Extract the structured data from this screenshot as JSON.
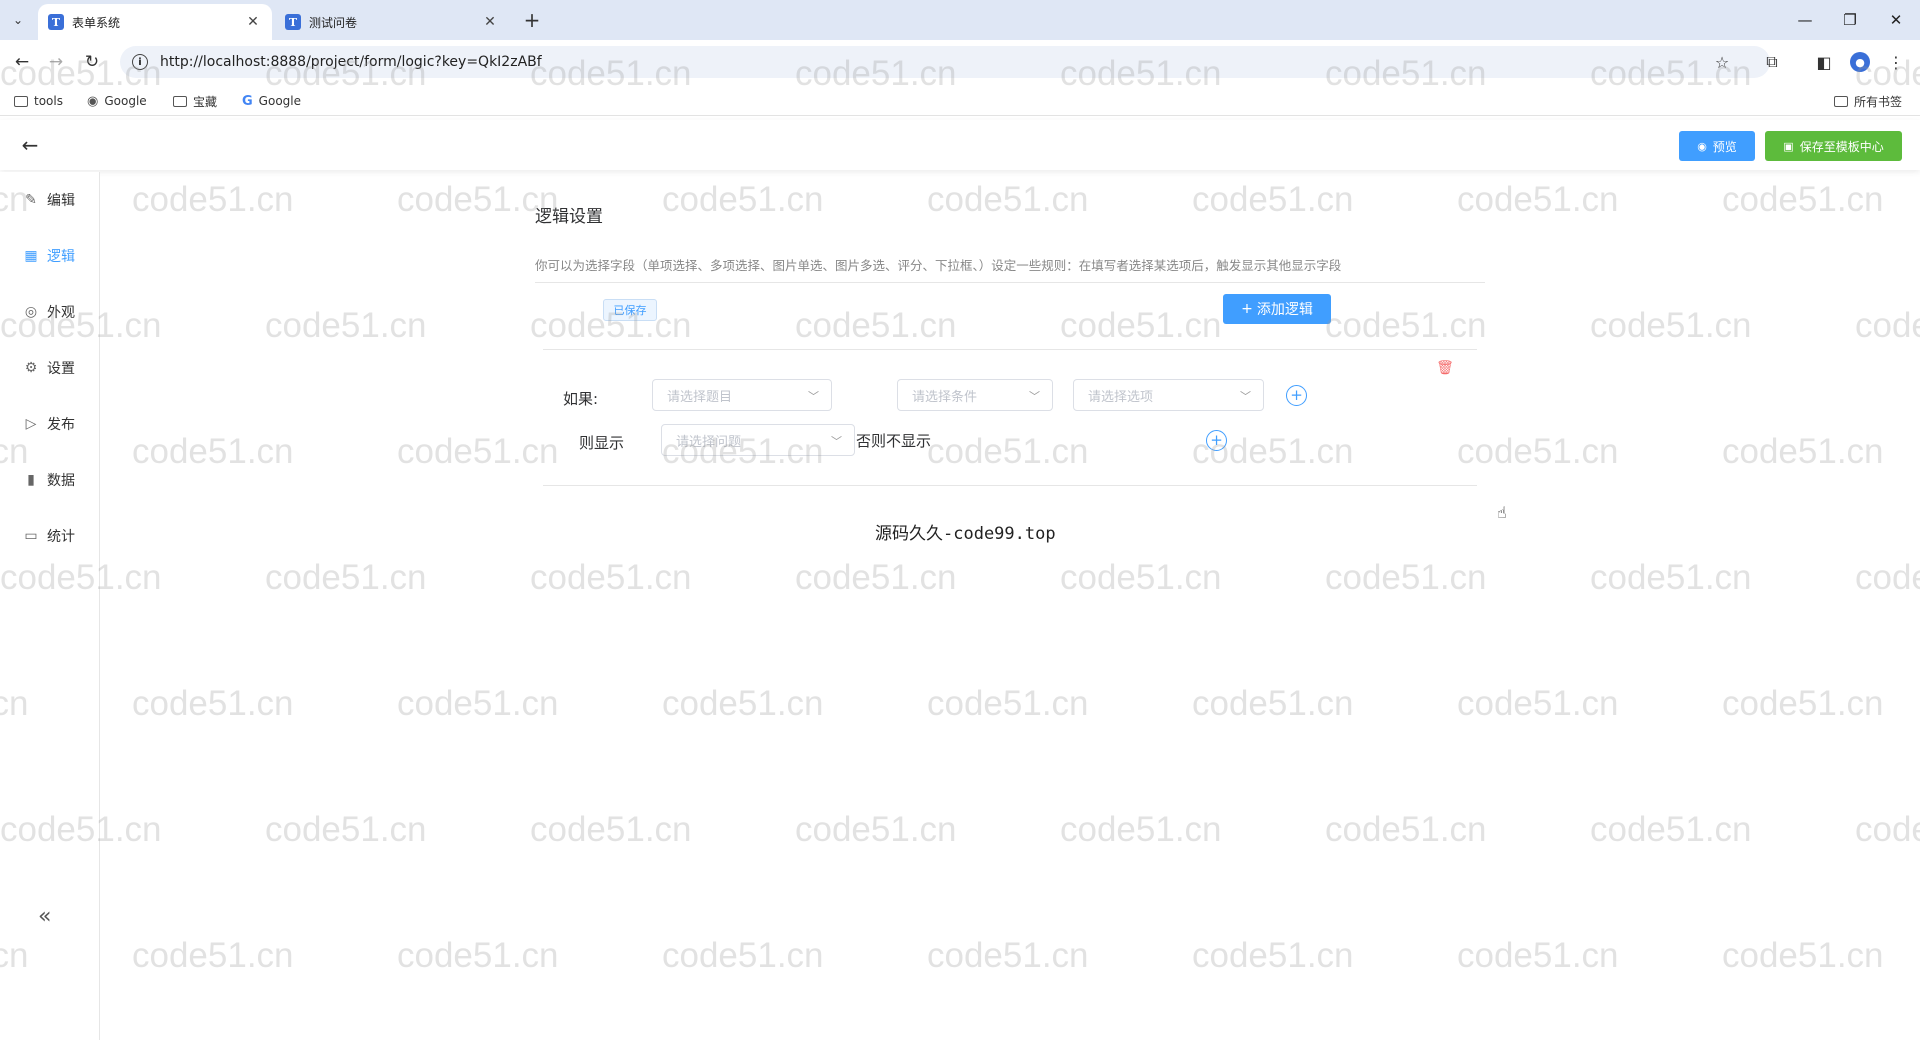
{
  "browser": {
    "tabs": [
      {
        "icon_letter": "T",
        "title": "表单系统",
        "close": "✕",
        "active": true
      },
      {
        "icon_letter": "T",
        "title": "测试问卷",
        "close": "✕",
        "active": false
      }
    ],
    "url": "http://localhost:8888/project/form/logic?key=QkI2zABf",
    "bookmarks": [
      {
        "icon": "folder-icon",
        "label": "tools"
      },
      {
        "icon": "globe-icon",
        "label": "Google"
      },
      {
        "icon": "folder-icon",
        "label": "宝藏"
      },
      {
        "icon": "google-g-icon",
        "label": "Google"
      }
    ],
    "all_bookmarks": "所有书签"
  },
  "header": {
    "preview_label": "预览",
    "save_template_label": "保存至模板中心"
  },
  "sidebar": {
    "items": [
      {
        "label": "编辑",
        "icon": "edit-icon",
        "active": false
      },
      {
        "label": "逻辑",
        "icon": "grid-icon",
        "active": true
      },
      {
        "label": "外观",
        "icon": "eye-icon",
        "active": false
      },
      {
        "label": "设置",
        "icon": "gear-icon",
        "active": false
      },
      {
        "label": "发布",
        "icon": "play-circle-icon",
        "active": false
      },
      {
        "label": "数据",
        "icon": "bar-chart-icon",
        "active": false
      },
      {
        "label": "统计",
        "icon": "stats-board-icon",
        "active": false
      }
    ],
    "collapse": "«"
  },
  "main": {
    "title": "逻辑设置",
    "description": "你可以为选择字段（单项选择、多项选择、图片单选、图片多选、评分、下拉框、）设定一些规则：在填写者选择某选项后，触发显示其他显示字段",
    "saved_tag": "已保存",
    "add_logic_label": "添加逻辑",
    "rule": {
      "if_label": "如果:",
      "question_placeholder": "请选择题目",
      "condition_placeholder": "请选择条件",
      "option_placeholder": "请选择选项",
      "then_label": "则显示",
      "show_question_placeholder": "请选择问题",
      "else_label": "否则不显示"
    }
  },
  "footer_credit": "源码久久-code99.top",
  "watermark_text": "code51.cn",
  "colors": {
    "primary": "#409eff",
    "success": "#5dbb3c",
    "danger": "#f56c6c"
  }
}
